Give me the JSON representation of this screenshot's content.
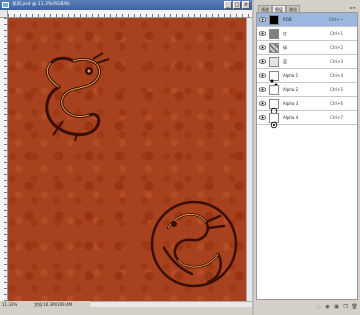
{
  "document": {
    "title": "龙凤.psd @ 11.3%(RGB/8)",
    "zoom": "11.33%",
    "doc_info": "文档:16.3M/109.4M"
  },
  "window_buttons": [
    "_",
    "□",
    "×"
  ],
  "panel": {
    "tabs": [
      "通道",
      "图层",
      "路径"
    ],
    "active_tab": 1,
    "layers": [
      {
        "name": "RGB",
        "shortcut": "Ctrl+~",
        "thumb": "black",
        "selected": true
      },
      {
        "name": "红",
        "shortcut": "Ctrl+1",
        "thumb": "gray-dark",
        "selected": false
      },
      {
        "name": "绿",
        "shortcut": "Ctrl+2",
        "thumb": "pattern",
        "selected": false
      },
      {
        "name": "蓝",
        "shortcut": "Ctrl+3",
        "thumb": "gray-light",
        "selected": false
      },
      {
        "name": "Alpha 1",
        "shortcut": "Ctrl+4",
        "thumb": "dots",
        "selected": false
      },
      {
        "name": "Alpha 2",
        "shortcut": "Ctrl+5",
        "thumb": "white",
        "selected": false
      },
      {
        "name": "Alpha 3",
        "shortcut": "Ctrl+6",
        "thumb": "circle",
        "selected": false
      },
      {
        "name": "Alpha 4",
        "shortcut": "Ctrl+7",
        "thumb": "circle2",
        "selected": false
      }
    ],
    "bottom_icons": [
      "dotted-circle-icon",
      "filled-circle-icon",
      "mask-icon",
      "new-channel-icon",
      "trash-icon"
    ]
  },
  "colors": {
    "canvas": "#a8421e",
    "selection": "#9cb7df",
    "motif_dark": "#3a0f0a"
  }
}
